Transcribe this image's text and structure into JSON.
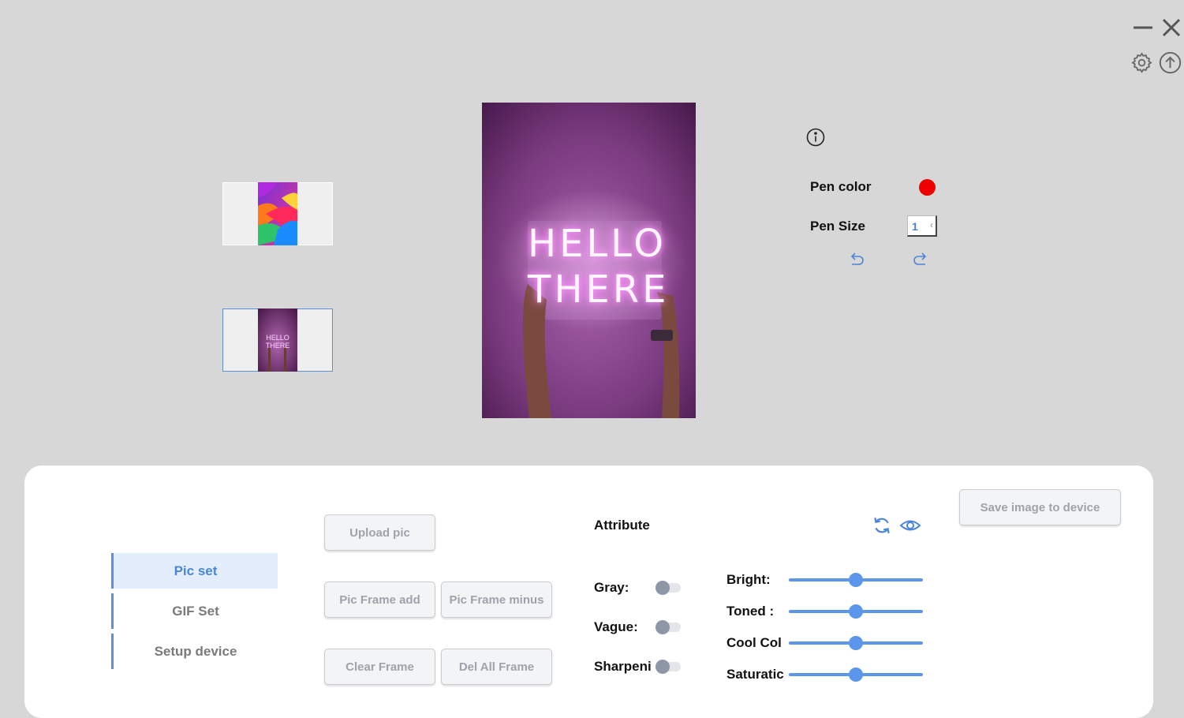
{
  "window": {
    "minimize_icon": "minimize-icon",
    "close_icon": "close-icon",
    "settings_icon": "gear-icon",
    "upload_icon": "upload-circle-icon"
  },
  "thumbnails": [
    {
      "name": "colorful abstract wallpaper",
      "selected": false
    },
    {
      "name": "neon hello there",
      "selected": true
    }
  ],
  "preview": {
    "neon_line1": "HELLO",
    "neon_line2": "THERE"
  },
  "pen_panel": {
    "info_icon": "info-icon",
    "pen_color_label": "Pen color",
    "pen_color": "#ee0000",
    "pen_size_label": "Pen Size",
    "pen_size_value": "1",
    "undo_icon": "undo-icon",
    "redo_icon": "redo-icon"
  },
  "nav": {
    "items": [
      {
        "label": "Pic set",
        "active": true
      },
      {
        "label": "GIF Set",
        "active": false
      },
      {
        "label": "Setup device",
        "active": false
      }
    ]
  },
  "buttons": {
    "upload_pic": "Upload pic",
    "pic_frame_add": "Pic Frame add",
    "pic_frame_minus": "Pic Frame minus",
    "clear_frame": "Clear Frame",
    "del_all_frame": "Del All Frame",
    "save_image": "Save image to device"
  },
  "attribute": {
    "title": "Attribute",
    "reset_icon": "refresh-icon",
    "preview_icon": "eye-icon",
    "toggles": [
      {
        "label": "Gray:",
        "on": false
      },
      {
        "label": "Vague:",
        "on": false
      },
      {
        "label": "Sharpeni",
        "on": false
      }
    ],
    "sliders": [
      {
        "label": "Bright:",
        "value": 0.5
      },
      {
        "label": "Toned :",
        "value": 0.5
      },
      {
        "label": "Cool Col",
        "value": 0.5
      },
      {
        "label": "Saturatic",
        "value": 0.5
      }
    ]
  },
  "colors": {
    "accent": "#5b96ea",
    "background": "#d7d7d7",
    "panel": "#ffffff"
  }
}
